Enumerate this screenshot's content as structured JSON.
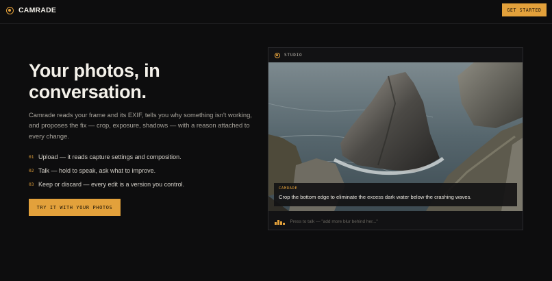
{
  "brand": {
    "name": "CAMRADE"
  },
  "header": {
    "cta_label": "GET STARTED"
  },
  "hero": {
    "title": "Your photos, in conversation.",
    "description": "Camrade reads your frame and its EXIF, tells you why something isn't working, and proposes the fix — crop, exposure, shadows — with a reason attached to every change.",
    "steps": [
      {
        "num": "01",
        "text": "Upload — it reads capture settings and composition."
      },
      {
        "num": "02",
        "text": "Talk — hold to speak, ask what to improve."
      },
      {
        "num": "03",
        "text": "Keep or discard — every edit is a version you control."
      }
    ],
    "cta_label": "TRY IT WITH YOUR PHOTOS"
  },
  "studio": {
    "label": "STUDIO",
    "caption_tag": "CAMRADE",
    "caption_text": "Crop the bottom edge to eliminate the excess dark water below the crashing waves.",
    "input_hint": "Press to talk — \"add more blur behind her...\""
  },
  "colors": {
    "accent": "#e3a13b",
    "background": "#0d0d0e"
  },
  "icons": {
    "logo": "camrade-logo-icon",
    "mic": "voice-bars-icon"
  }
}
